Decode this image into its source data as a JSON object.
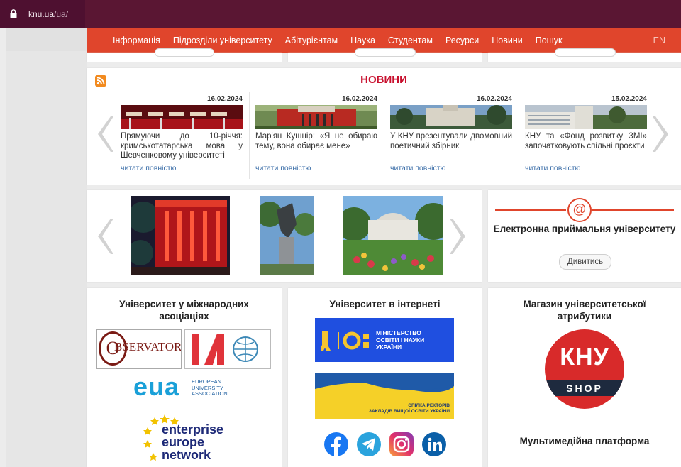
{
  "browser": {
    "url_host": "knu.ua",
    "url_path": "/ua/"
  },
  "nav": {
    "items": [
      "Інформація",
      "Підрозділи університету",
      "Абітурієнтам",
      "Наука",
      "Студентам",
      "Ресурси",
      "Новини",
      "Пошук"
    ],
    "lang": "EN"
  },
  "news": {
    "title": "НОВИНИ",
    "more_label": "читати повністю",
    "items": [
      {
        "date": "16.02.2024",
        "text": "Прямуючи до 10-річчя: кримськотатарська мова у Шевченковому університеті"
      },
      {
        "date": "16.02.2024",
        "text": "Мар'ян Кушнір: «Я не обираю тему, вона обирає мене»"
      },
      {
        "date": "16.02.2024",
        "text": "У КНУ презентували двомовний поетичний збірник"
      },
      {
        "date": "15.02.2024",
        "text": "КНУ та «Фонд розвитку ЗМІ» започатковують спільні проєкти"
      }
    ]
  },
  "reception": {
    "icon": "@",
    "title": "Електронна приймальня університету",
    "button": "Дивитись"
  },
  "associations": {
    "title": "Університет у міжнародних асоціаціях",
    "logos": {
      "observatory": "BSERVATORY",
      "observatory_o": "O",
      "eua_big": "eua",
      "eua_small": [
        "EUROPEAN",
        "UNIVERSITY",
        "ASSOCIATION"
      ],
      "een": [
        "enterprise",
        "europe",
        "network"
      ]
    }
  },
  "internet": {
    "title": "Університет в інтернеті",
    "mon": [
      "МІНІСТЕРСТВО",
      "ОСВІТИ І НАУКИ",
      "УКРАЇНИ"
    ],
    "rectors": [
      "СПІЛКА РЕКТОРІВ",
      "ЗАКЛАДІВ ВИЩОЇ ОСВІТИ УКРАЇНИ"
    ],
    "social": [
      "facebook-icon",
      "telegram-icon",
      "instagram-icon",
      "linkedin-icon"
    ]
  },
  "shop": {
    "title": "Магазин університетської атрибутики",
    "logo_top": "КНУ",
    "logo_bottom": "SHOP",
    "multimedia": "Мультимедійна платформа"
  },
  "colors": {
    "nav": "#e0452c",
    "address_bar": "#5a1633",
    "news_title": "#c8102e",
    "link": "#3b6ea8"
  }
}
